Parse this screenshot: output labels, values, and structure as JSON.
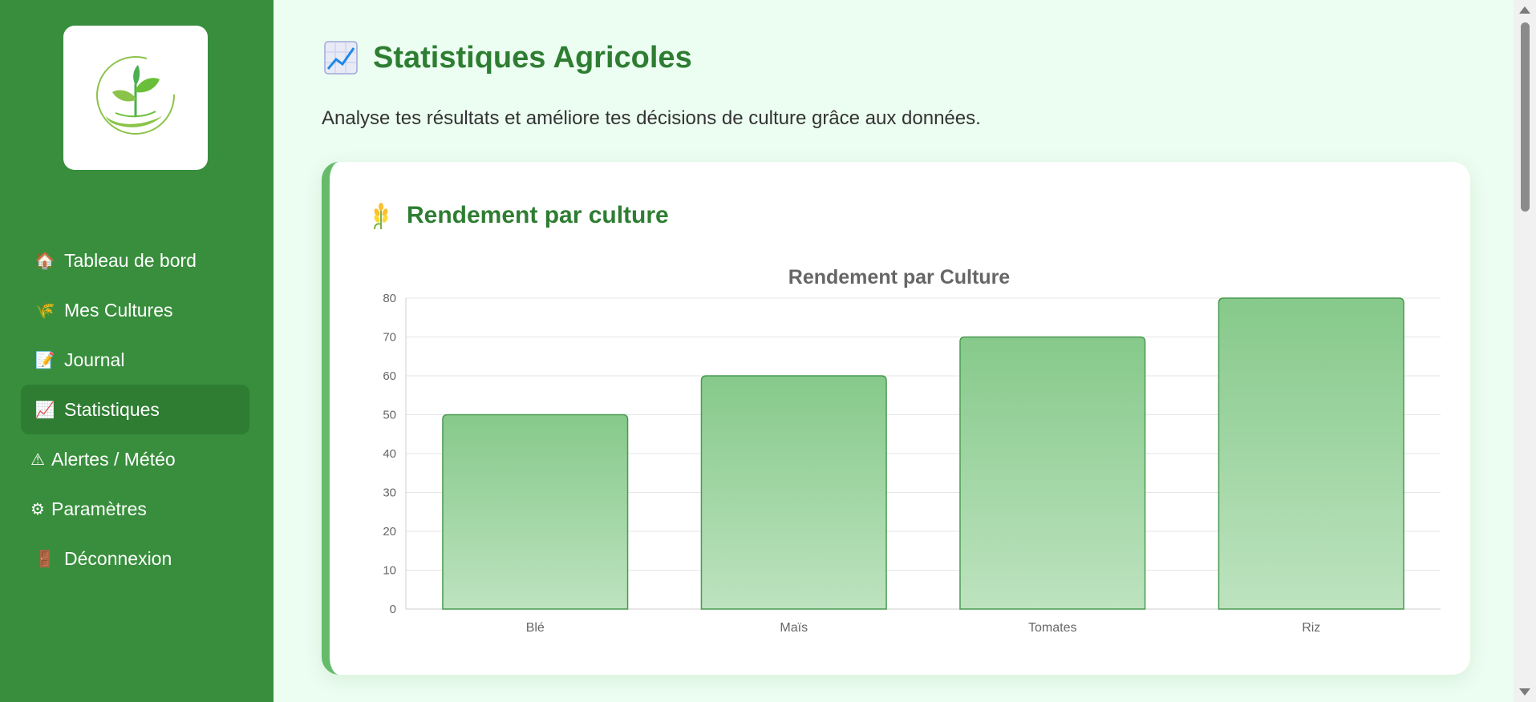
{
  "sidebar": {
    "logo_icon": "plant-in-hand-logo",
    "items": [
      {
        "icon": "house-icon",
        "glyph": "🏠",
        "label": "Tableau de bord",
        "active": false
      },
      {
        "icon": "wheat-icon",
        "glyph": "🌾",
        "label": "Mes Cultures",
        "active": false
      },
      {
        "icon": "memo-icon",
        "glyph": "📝",
        "label": "Journal",
        "active": false
      },
      {
        "icon": "chart-increasing-icon",
        "glyph": "📈",
        "label": "Statistiques",
        "active": true
      },
      {
        "icon": "warning-icon",
        "glyph": "⚠",
        "label": "Alertes / Météo",
        "active": false
      },
      {
        "icon": "gear-icon",
        "glyph": "⚙",
        "label": "Paramètres",
        "active": false
      },
      {
        "icon": "door-icon",
        "glyph": "🚪",
        "label": "Déconnexion",
        "active": false
      }
    ]
  },
  "header": {
    "title": "Statistiques Agricoles",
    "title_icon": "chart-increasing-icon",
    "subtitle": "Analyse tes résultats et améliore tes décisions de culture grâce aux données."
  },
  "card": {
    "title": "Rendement par culture",
    "title_icon": "wheat-icon"
  },
  "colors": {
    "sidebar_bg": "#388e3c",
    "active_item_bg": "#2e7d32",
    "accent": "#2e7d32",
    "bar_fill_top": "#86c98a",
    "bar_fill_bottom": "#bde3bf",
    "bar_stroke": "#4a9a50"
  },
  "chart_data": {
    "type": "bar",
    "title": "Rendement par Culture",
    "categories": [
      "Blé",
      "Maïs",
      "Tomates",
      "Riz"
    ],
    "values": [
      50,
      60,
      70,
      80
    ],
    "ylim": [
      0,
      80
    ],
    "yticks": [
      0,
      10,
      20,
      30,
      40,
      50,
      60,
      70,
      80
    ],
    "xlabel": "",
    "ylabel": "",
    "grid": true,
    "legend": "none"
  }
}
